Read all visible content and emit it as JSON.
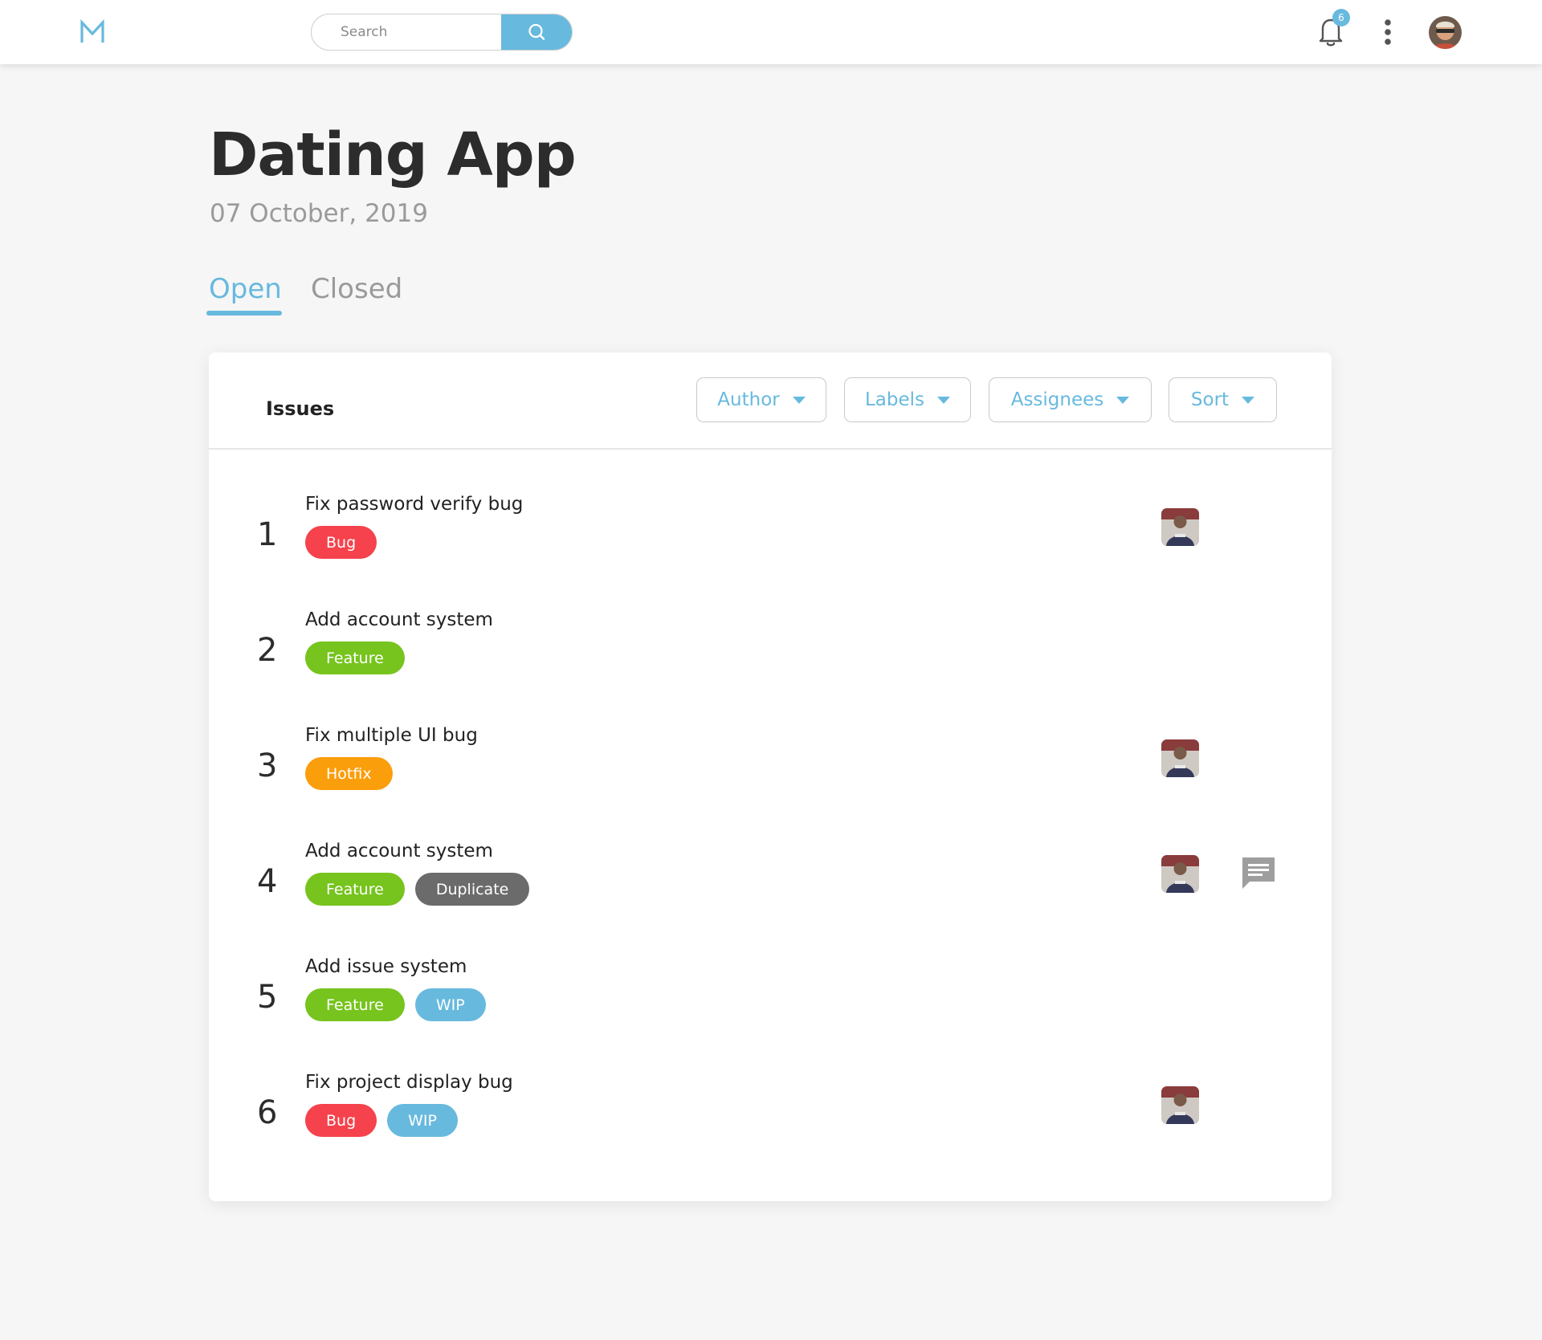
{
  "topbar": {
    "logo_icon": "m-logo-icon",
    "search": {
      "placeholder": "Search"
    },
    "notifications": {
      "icon": "bell-icon",
      "count": "6"
    },
    "menu_icon": "kebab-menu-icon",
    "avatar_icon": "user-avatar"
  },
  "project": {
    "title": "Dating App",
    "date": "07 October, 2019"
  },
  "tabs": [
    {
      "label": "Open",
      "active": true
    },
    {
      "label": "Closed",
      "active": false
    }
  ],
  "issues_panel": {
    "title": "Issues",
    "filters": [
      {
        "label": "Author"
      },
      {
        "label": "Labels"
      },
      {
        "label": "Assignees"
      },
      {
        "label": "Sort"
      }
    ]
  },
  "tag_colors": {
    "Bug": "#f5424c",
    "Feature": "#76c41d",
    "Hotfix": "#fb9e0b",
    "Duplicate": "#6b6b6b",
    "WIP": "#68b9de"
  },
  "accent_color": "#68b9de",
  "issues": [
    {
      "number": "1",
      "title": "Fix password verify bug",
      "tags": [
        "Bug"
      ],
      "assignee": true,
      "comments": false
    },
    {
      "number": "2",
      "title": "Add account system",
      "tags": [
        "Feature"
      ],
      "assignee": false,
      "comments": false
    },
    {
      "number": "3",
      "title": "Fix multiple UI bug",
      "tags": [
        "Hotfix"
      ],
      "assignee": true,
      "comments": false
    },
    {
      "number": "4",
      "title": "Add account system",
      "tags": [
        "Feature",
        "Duplicate"
      ],
      "assignee": true,
      "comments": true
    },
    {
      "number": "5",
      "title": "Add issue system",
      "tags": [
        "Feature",
        "WIP"
      ],
      "assignee": false,
      "comments": false
    },
    {
      "number": "6",
      "title": "Fix project display bug",
      "tags": [
        "Bug",
        "WIP"
      ],
      "assignee": true,
      "comments": false
    }
  ]
}
